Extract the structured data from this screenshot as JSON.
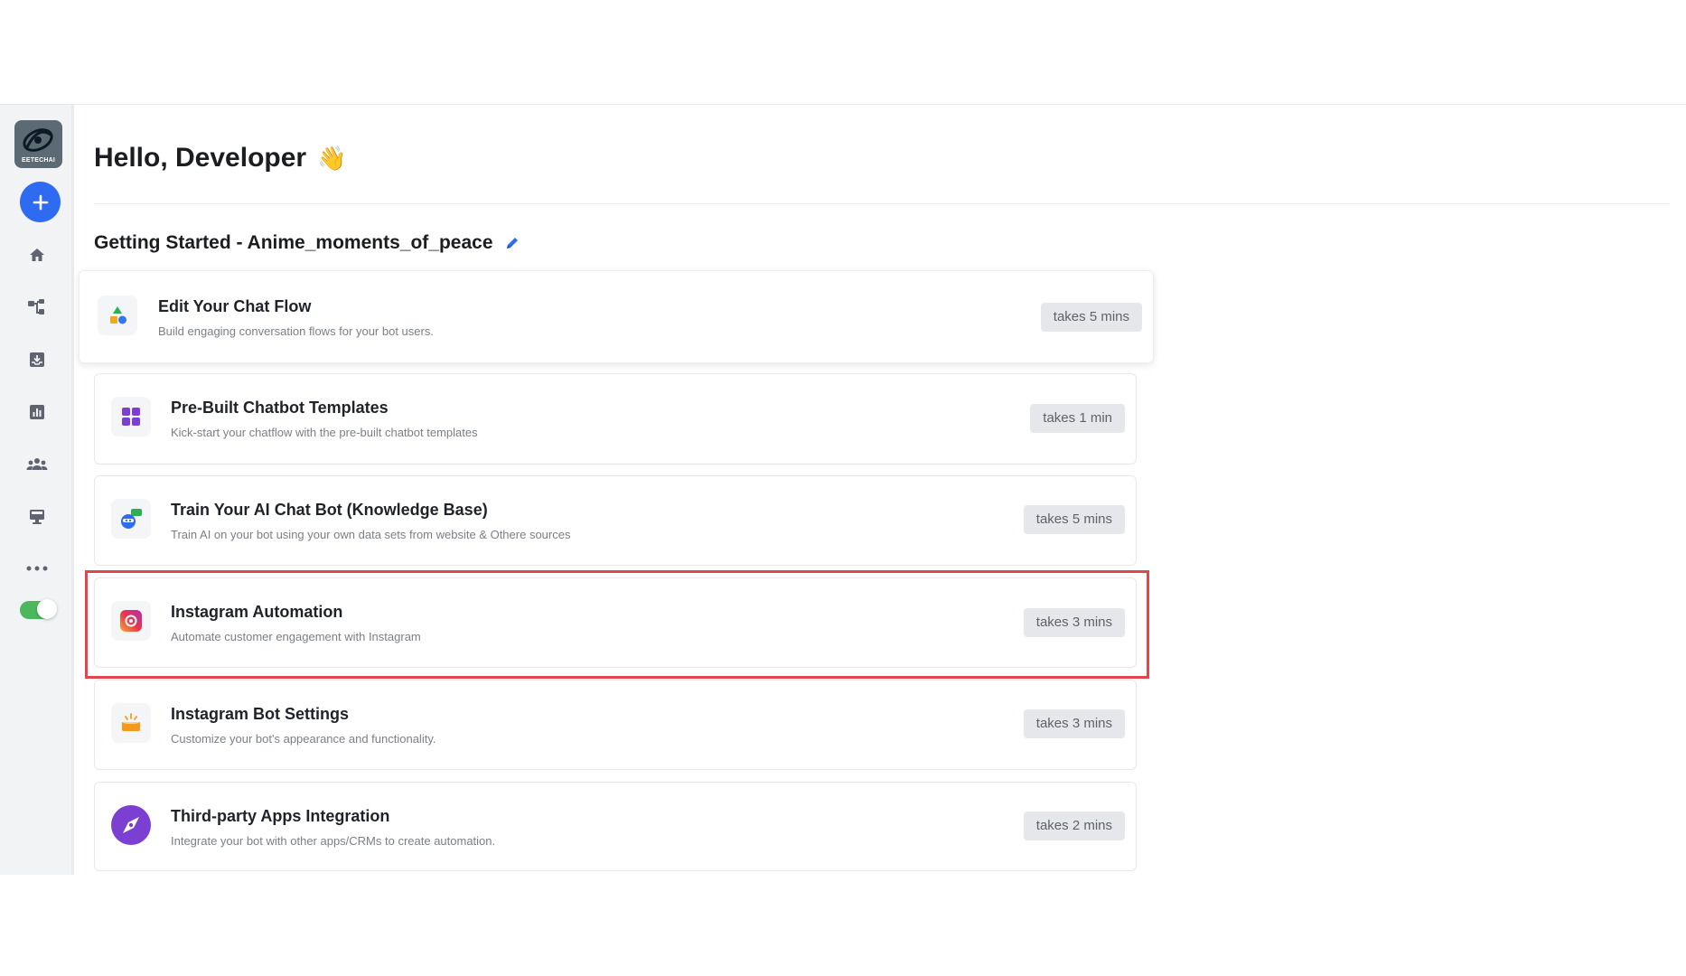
{
  "sidebar": {
    "logo_text": "EETECHAI",
    "icons": [
      "add-icon",
      "home-icon",
      "flow-icon",
      "inbox-icon",
      "analytics-icon",
      "users-icon",
      "monitor-icon",
      "more-icon",
      "toggle"
    ]
  },
  "greeting": {
    "text": "Hello, Developer",
    "emoji": "👋"
  },
  "section": {
    "title": "Getting Started - Anime_moments_of_peace"
  },
  "cards": [
    {
      "title": "Edit Your Chat Flow",
      "desc": "Build engaging conversation flows for your bot users.",
      "badge": "takes 5 mins"
    },
    {
      "title": "Pre-Built Chatbot Templates",
      "desc": "Kick-start your chatflow with the pre-built chatbot templates",
      "badge": "takes 1 min"
    },
    {
      "title": "Train Your AI Chat Bot (Knowledge Base)",
      "desc": "Train AI on your bot using your own data sets from website & Othere sources",
      "badge": "takes 5 mins"
    },
    {
      "title": "Instagram Automation",
      "desc": "Automate customer engagement with Instagram",
      "badge": "takes 3 mins"
    },
    {
      "title": "Instagram Bot Settings",
      "desc": "Customize your bot's appearance and functionality.",
      "badge": "takes 3 mins"
    },
    {
      "title": "Third-party Apps Integration",
      "desc": "Integrate your bot with other apps/CRMs to create automation.",
      "badge": "takes 2 mins"
    }
  ],
  "colors": {
    "accent": "#2f6bf0",
    "highlight": "#e0474c",
    "toggle_on": "#4bb85e"
  }
}
